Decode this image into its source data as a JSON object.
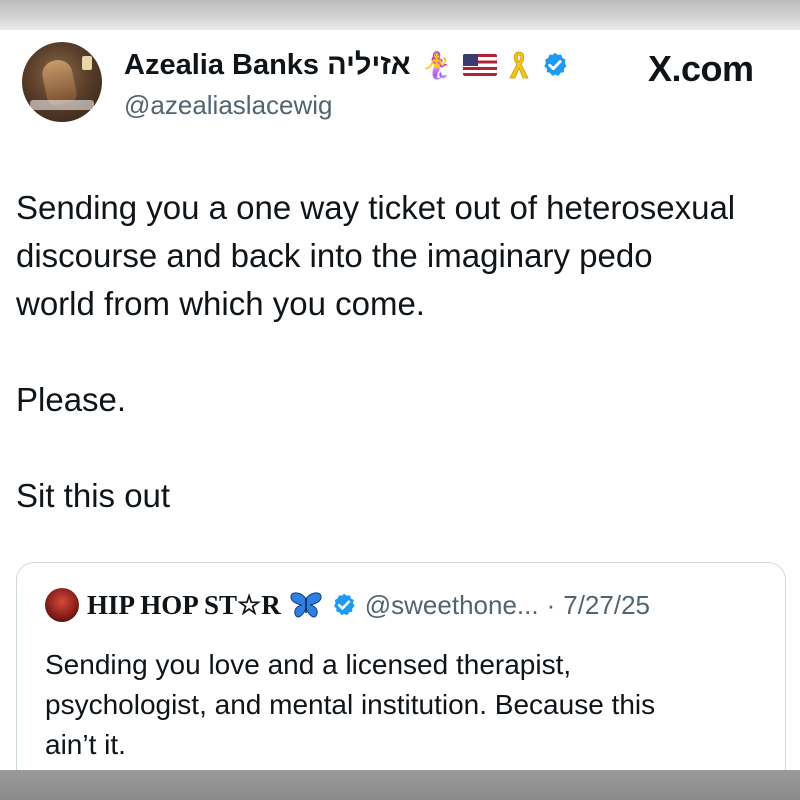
{
  "post": {
    "author": {
      "display_name": "Azealia Banks",
      "hebrew_name": "אזיליה",
      "handle": "@azealiaslacewig",
      "badges": [
        "mermaid-emoji",
        "us-flag-icon",
        "yellow-ribbon-icon",
        "verified-badge-icon"
      ],
      "mermaid_emoji": "🧜‍♀️"
    },
    "brand": "X.com",
    "text_lines": [
      "Sending you a one way ticket out of heterosexual",
      "discourse and back into the imaginary pedo",
      "world from which you come."
    ],
    "text_line_2": "Please.",
    "text_line_3": "Sit this out"
  },
  "quoted_post": {
    "author_name": "HIP HOP ST☆R",
    "handle": "@sweethone...",
    "separator": "·",
    "date": "7/27/25",
    "badges": [
      "butterfly-icon",
      "verified-badge-icon"
    ],
    "text_lines": [
      "Sending you love and a licensed therapist,",
      "psychologist, and mental institution. Because this",
      "ain’t it."
    ]
  },
  "colors": {
    "verified_blue": "#1d9bf0",
    "secondary_text": "#536471",
    "primary_text": "#0f1419",
    "quote_border": "#cfd9de",
    "ribbon_yellow": "#f5c518",
    "butterfly_blue": "#2f7fe0"
  }
}
